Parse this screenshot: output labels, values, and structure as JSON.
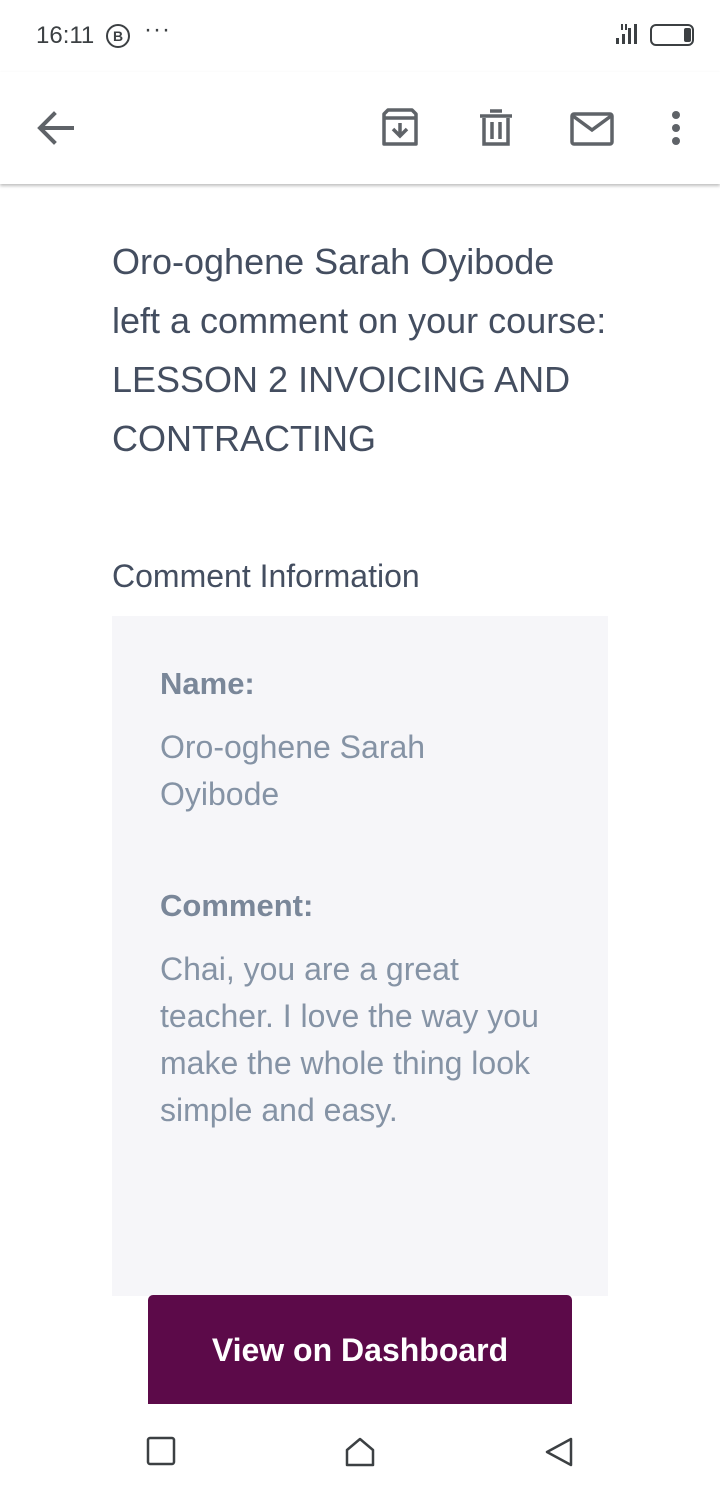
{
  "status_bar": {
    "time": "16:11",
    "badge": "B",
    "more": "···",
    "icons": [
      "signal-icon",
      "battery-icon"
    ]
  },
  "toolbar": {
    "icons": [
      "back-arrow-icon",
      "archive-icon",
      "delete-icon",
      "mark-unread-icon",
      "more-vert-icon"
    ]
  },
  "email": {
    "headline": "Oro-oghene Sarah Oyibode left a comment on your course: LESSON 2 INVOICING AND CONTRACTING",
    "section_title": "Comment Information",
    "name_label": "Name:",
    "name_value": "Oro-oghene Sarah Oyibode",
    "comment_label": "Comment:",
    "comment_value": "Chai, you are a great teacher. I love the way you make the whole thing look simple and easy.",
    "button_label": "View on Dashboard"
  },
  "colors": {
    "text_dark": "#444e60",
    "text_muted": "#8593a5",
    "panel_bg": "#f6f6f9",
    "button_bg": "#5c0a49",
    "button_text": "#ffffff"
  },
  "nav_bar": {
    "icons": [
      "recents-square-icon",
      "home-icon",
      "back-triangle-icon"
    ]
  }
}
